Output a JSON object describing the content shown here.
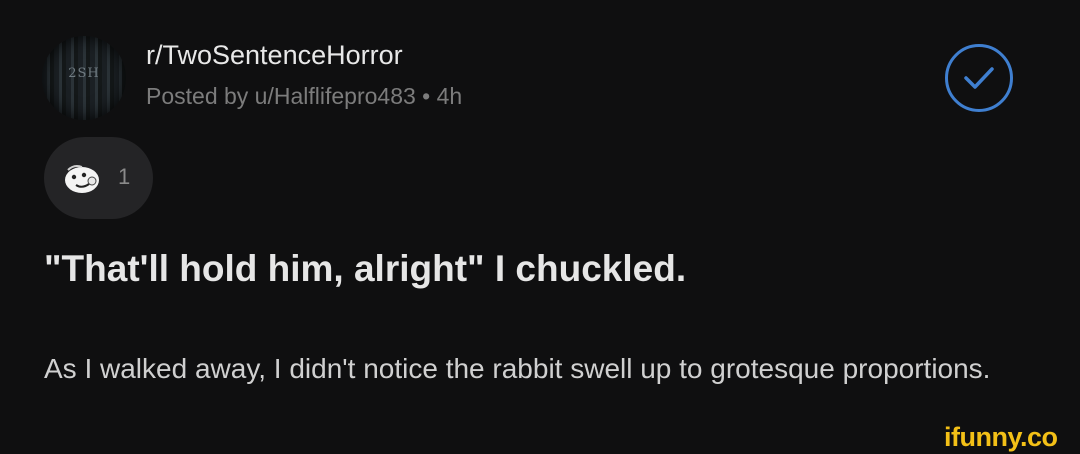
{
  "post": {
    "subreddit": "r/TwoSentenceHorror",
    "subreddit_avatar_text": "2SH",
    "meta": "Posted by u/Halflifepro483 • 4h",
    "joined_icon": "check-circle-icon",
    "award": {
      "icon": "silly-award-icon",
      "count": "1"
    },
    "title": "\"That'll hold him, alright\" I chuckled.",
    "body": "As I walked away, I didn't notice the rabbit swell up to grotesque proportions."
  },
  "watermark": "ifunny.co",
  "colors": {
    "background": "#0f0f10",
    "accent": "#3f7fd0",
    "watermark": "#f3c017",
    "pill": "#242426"
  }
}
